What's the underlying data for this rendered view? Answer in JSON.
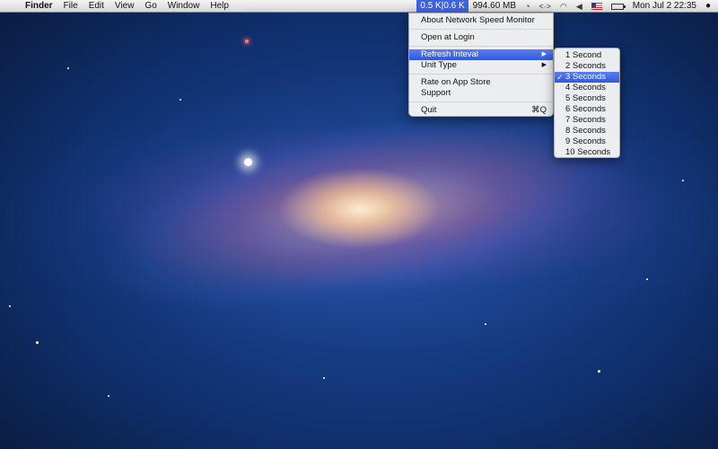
{
  "menubar": {
    "apple": "",
    "items": [
      "Finder",
      "File",
      "Edit",
      "View",
      "Go",
      "Window",
      "Help"
    ],
    "speed": "0.5 K|0.6 K",
    "memory": "994.60 MB",
    "datetime": "Mon Jul 2  22:35"
  },
  "menu": {
    "about": "About Network Speed Monitor",
    "open_login": "Open at Login",
    "refresh": "Refresh Inteval",
    "unit": "Unit Type",
    "rate": "Rate on App Store",
    "support": "Support",
    "quit": "Quit",
    "quit_shortcut": "⌘Q",
    "arrow": "▶"
  },
  "submenu": {
    "items": [
      "1 Second",
      "2 Seconds",
      "3 Seconds",
      "4 Seconds",
      "5 Seconds",
      "6 Seconds",
      "7 Seconds",
      "8 Seconds",
      "9 Seconds",
      "10 Seconds"
    ],
    "selected": "3 Seconds",
    "check": "✓"
  },
  "icons": {
    "status_icons": [
      "time-machine-icon",
      "network-arrows-icon",
      "wifi-icon",
      "volume-icon",
      "flag-icon",
      "battery-icon",
      "user-icon"
    ]
  },
  "colors": {
    "highlight": "#3d63e0"
  }
}
